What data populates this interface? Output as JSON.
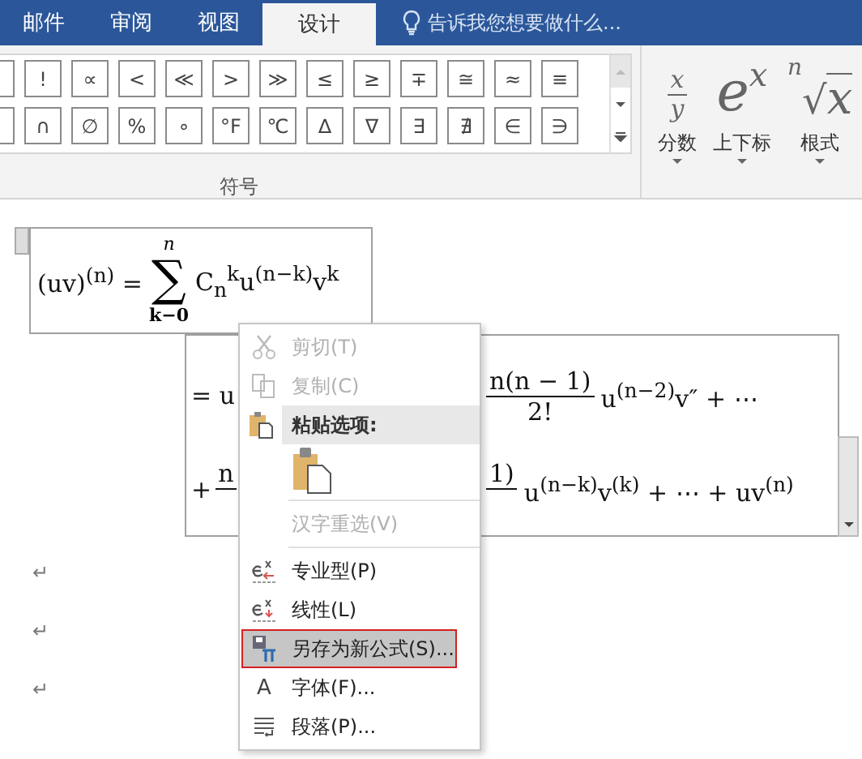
{
  "tabs": [
    {
      "label": "邮件",
      "selected": false
    },
    {
      "label": "审阅",
      "selected": false
    },
    {
      "label": "视图",
      "selected": false
    },
    {
      "label": "设计",
      "selected": true
    }
  ],
  "tell_me": {
    "placeholder": "告诉我您想要做什么..."
  },
  "symbols": {
    "rows": [
      [
        "!",
        "∝",
        "<",
        "≪",
        ">",
        "≫",
        "≤",
        "≥",
        "∓",
        "≅",
        "≈",
        "≡"
      ],
      [
        "∩",
        "∅",
        "%",
        "∘",
        "°F",
        "℃",
        "∆",
        "∇",
        "∃",
        "∄",
        "∈",
        "∋"
      ]
    ],
    "group_label": "符号"
  },
  "structures": [
    {
      "kind": "fraction",
      "parts": [
        "x",
        "y"
      ],
      "label": "分数"
    },
    {
      "kind": "script",
      "parts": [
        "e",
        "x"
      ],
      "label": "上下标"
    },
    {
      "kind": "radical",
      "parts": [
        "n",
        "√",
        "x"
      ],
      "label": "根式"
    }
  ],
  "equation": {
    "line_1": {
      "lhs": "(uv)$^{(n)}$ =",
      "sum": "∑",
      "sum_upper": "n",
      "sum_lower": "k−0",
      "rhs": "C$_{n}$$^{k}$u$^{(n−k)}$v$^{k}$"
    },
    "line_2": {
      "start": "= u",
      "numerator": "n(n − 1)",
      "denominator": "2!",
      "tail": "u$^{(n−2)}$v″ + ⋯"
    },
    "line_3": {
      "start": "+",
      "numerator_left": "n",
      "numerator_right": "1)",
      "tail": "u$^{(n−k)}$v$^{(k)}$ + ⋯ + uv$^{(n)}$"
    }
  },
  "paragraph_marks": [
    "↵",
    "↵",
    "↵"
  ],
  "context_menu": [
    {
      "kind": "cut",
      "label": "剪切(T)",
      "disabled": true,
      "selected": false
    },
    {
      "kind": "copy",
      "label": "复制(C)",
      "disabled": true,
      "selected": false
    },
    {
      "kind": "paste-header",
      "label": "粘贴选项:"
    },
    {
      "kind": "paste"
    },
    {
      "kind": "separator"
    },
    {
      "kind": "plain",
      "label": "汉字重选(V)",
      "disabled": true,
      "selected": false
    },
    {
      "kind": "separator"
    },
    {
      "kind": "professional",
      "label": "专业型(P)",
      "disabled": false,
      "selected": false
    },
    {
      "kind": "linear",
      "label": "线性(L)",
      "disabled": false,
      "selected": false
    },
    {
      "kind": "save",
      "label": "另存为新公式(S)...",
      "disabled": false,
      "selected": true
    },
    {
      "kind": "font",
      "glyph": "A",
      "label": "字体(F)...",
      "disabled": false,
      "selected": false
    },
    {
      "kind": "paragraph",
      "label": "段落(P)...",
      "disabled": false,
      "selected": false
    }
  ]
}
